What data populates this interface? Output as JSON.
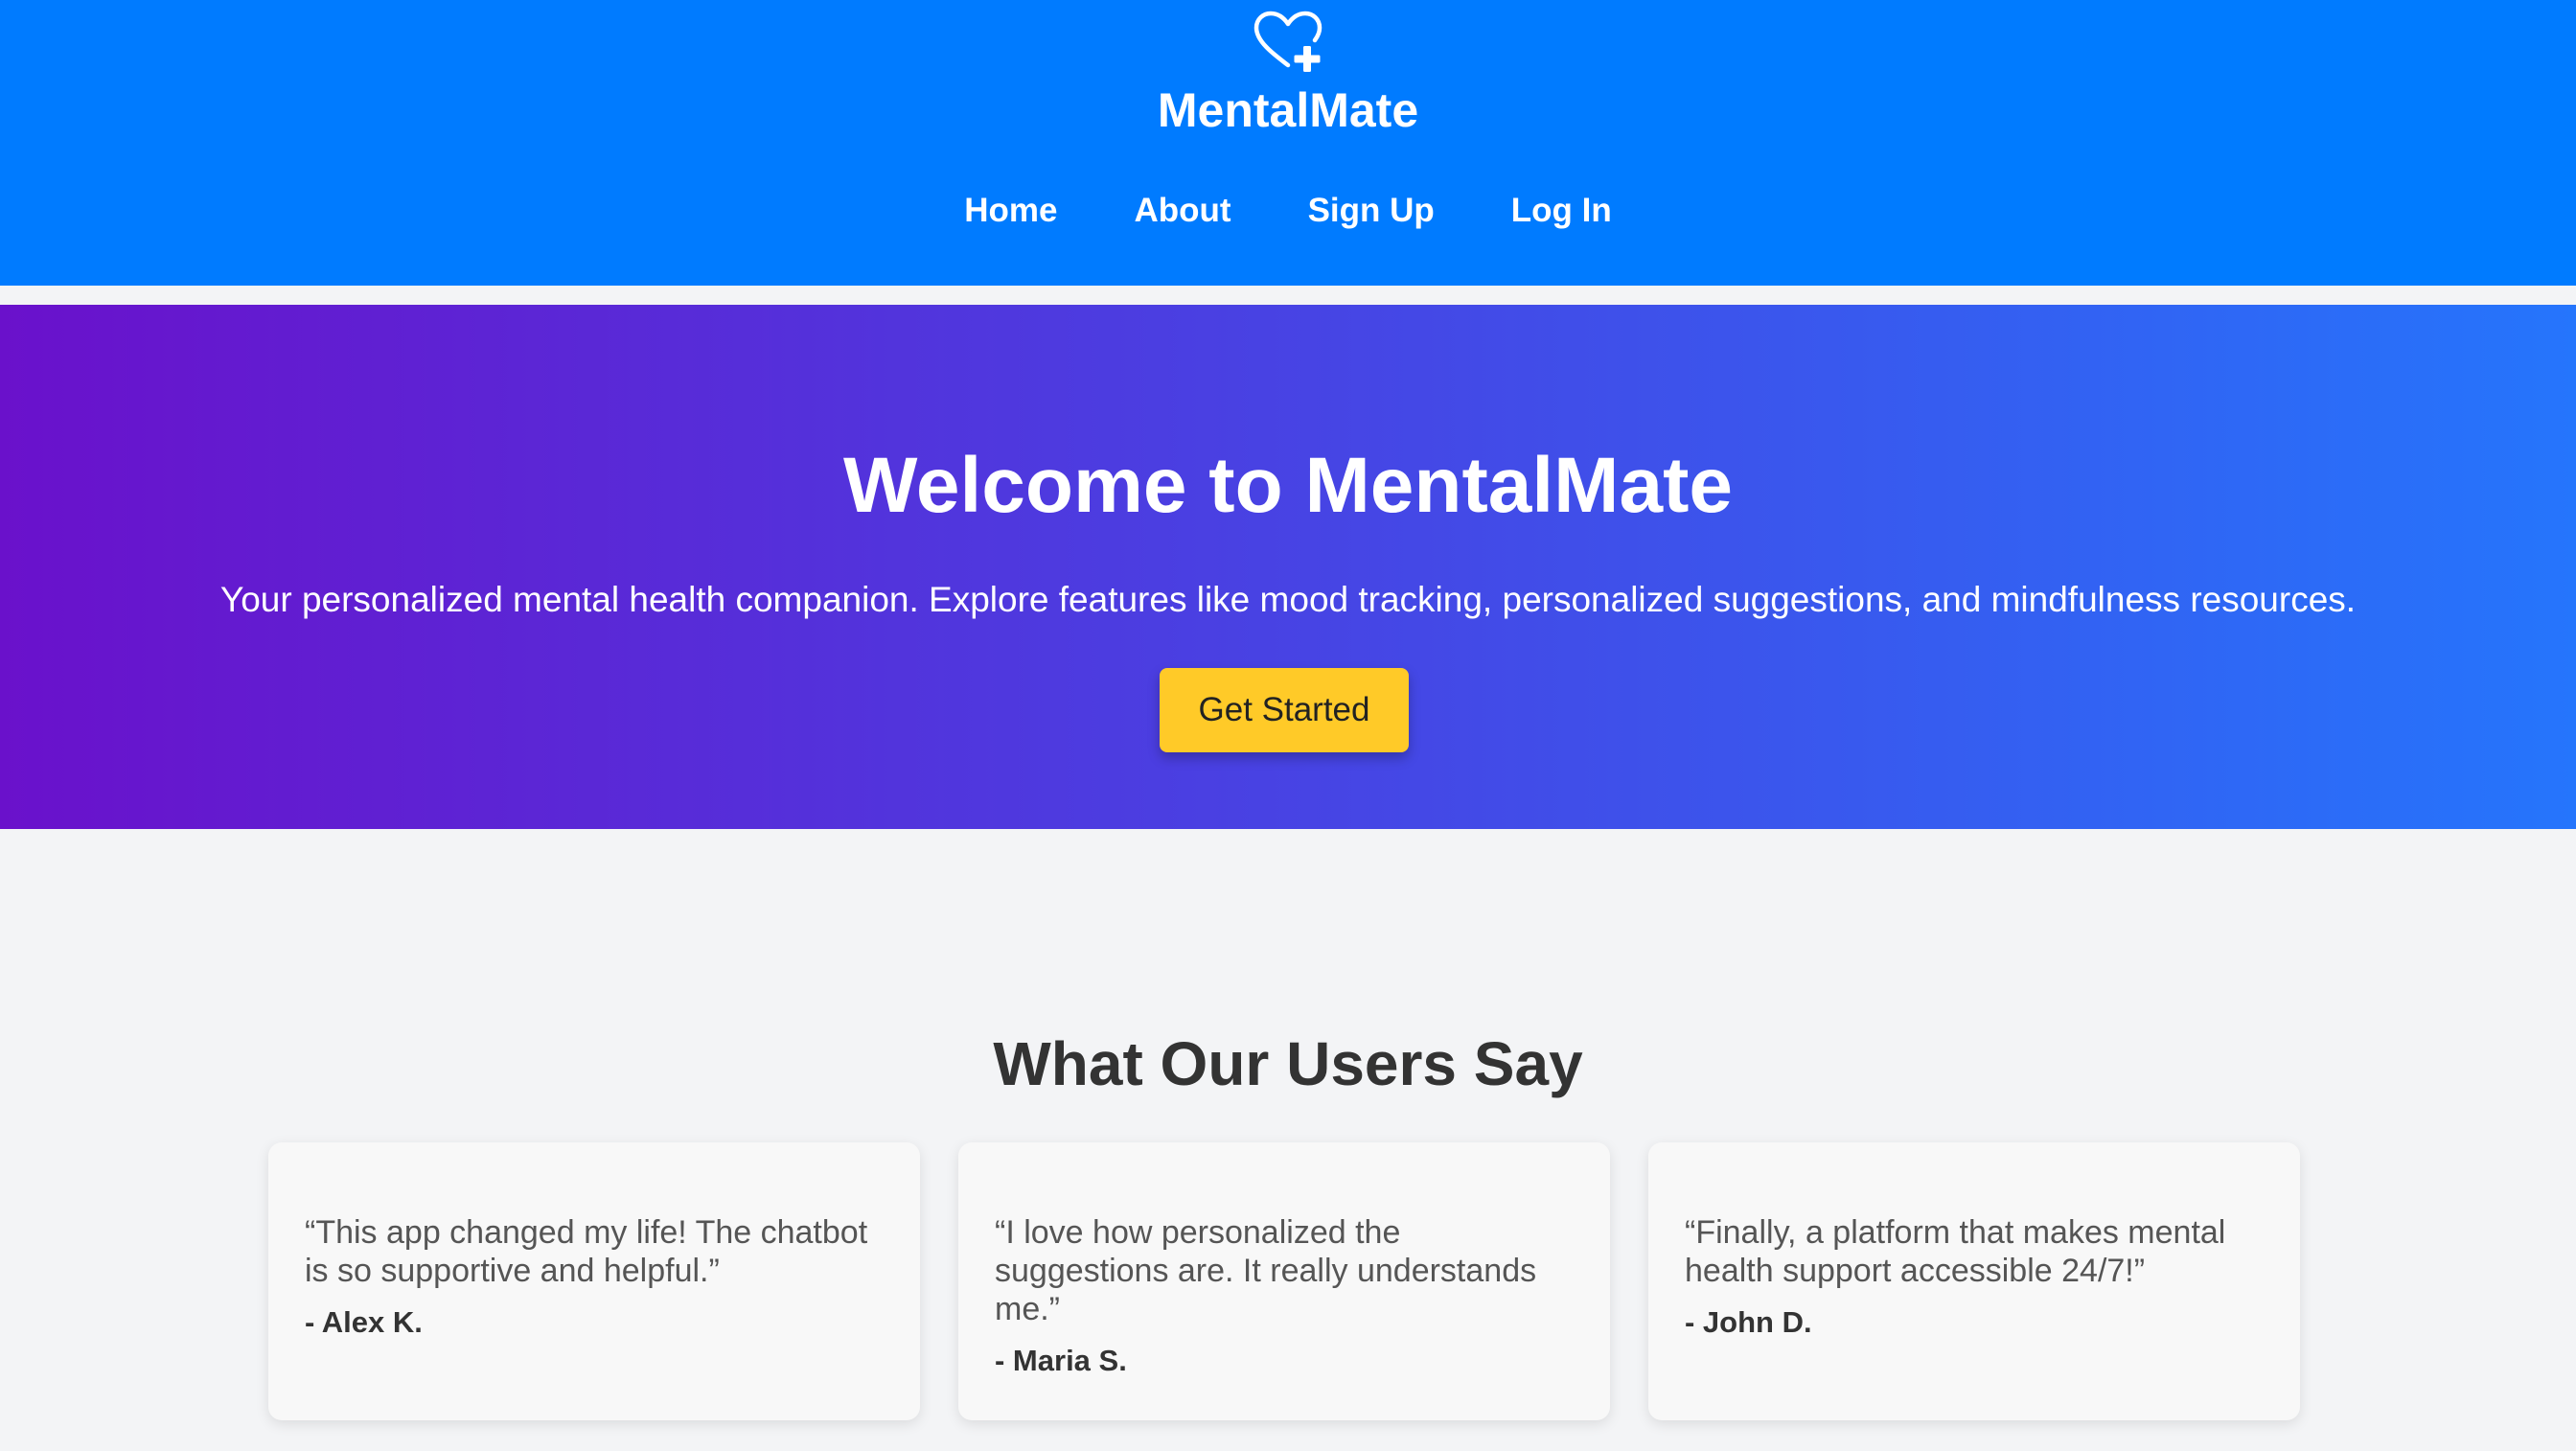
{
  "header": {
    "logo_icon": "heart-plus-icon",
    "brand": "MentalMate",
    "nav": [
      "Home",
      "About",
      "Sign Up",
      "Log In"
    ],
    "color": "#007bff"
  },
  "hero": {
    "title": "Welcome to MentalMate",
    "subtitle": "Your personalized mental health companion. Explore features like mood tracking, personalized suggestions, and mindfulness resources.",
    "cta_label": "Get Started",
    "gradient_start": "#6a11cb",
    "gradient_end": "#2575fc",
    "cta_color": "#ffca28"
  },
  "testimonials": {
    "title": "What Our Users Say",
    "items": [
      {
        "quote": "“This app changed my life! The chatbot is so supportive and helpful.”",
        "author": "- Alex K."
      },
      {
        "quote": "“I love how personalized the suggestions are. It really understands me.”",
        "author": "- Maria S."
      },
      {
        "quote": "“Finally, a platform that makes mental health support accessible 24/7!”",
        "author": "- John D."
      }
    ]
  }
}
